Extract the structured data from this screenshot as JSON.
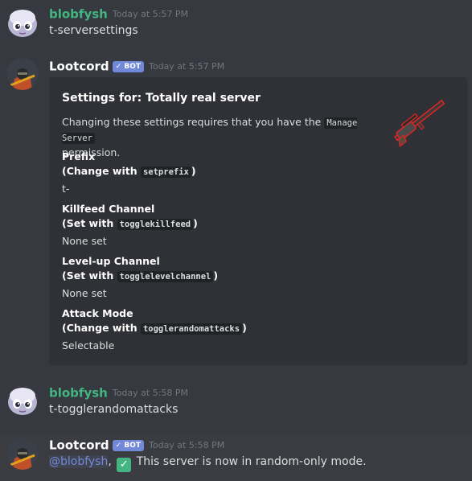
{
  "colors": {
    "user_name": "#43b581",
    "bot_name": "#ffffff",
    "bot_tag_bg": "#7289da",
    "mention": "#7289da",
    "embed_bg": "#2f3136"
  },
  "messages": [
    {
      "author": "blobfysh",
      "timestamp": "Today at 5:57 PM",
      "text": "t-serversettings",
      "avatar_icon": "blob-avatar"
    },
    {
      "author": "Lootcord",
      "bot_tag": "✓ BOT",
      "timestamp": "Today at 5:57 PM",
      "avatar_icon": "soldier-avatar",
      "embed": {
        "title": "Settings for: Totally real server",
        "desc_prefix": "Changing these settings requires that you have the",
        "desc_code": "Manage Server",
        "desc_suffix": "permission.",
        "thumbnail_icon": "sniper-rifle-icon",
        "fields": [
          {
            "name_prefix": "Prefix",
            "hint_prefix": "(Change with",
            "hint_code": "setprefix",
            "hint_suffix": ")",
            "value": "t-"
          },
          {
            "name_prefix": "Killfeed Channel",
            "hint_prefix": "(Set with",
            "hint_code": "togglekillfeed",
            "hint_suffix": ")",
            "value": "None set"
          },
          {
            "name_prefix": "Level-up Channel",
            "hint_prefix": "(Set with",
            "hint_code": "togglelevelchannel",
            "hint_suffix": ")",
            "value": "None set"
          },
          {
            "name_prefix": "Attack Mode",
            "hint_prefix": "(Change with",
            "hint_code": "togglerandomattacks",
            "hint_suffix": ")",
            "value": "Selectable"
          }
        ]
      }
    },
    {
      "author": "blobfysh",
      "timestamp": "Today at 5:58 PM",
      "text": "t-togglerandomattacks",
      "avatar_icon": "blob-avatar"
    },
    {
      "author": "Lootcord",
      "bot_tag": "✓ BOT",
      "timestamp": "Today at 5:58 PM",
      "avatar_icon": "soldier-avatar",
      "mention": "@blobfysh",
      "separator": ",",
      "check_icon": "✓",
      "text": " This server is now in random-only mode."
    }
  ]
}
